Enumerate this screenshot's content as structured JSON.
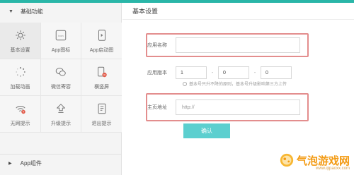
{
  "sidebar": {
    "section_title": "基础功能",
    "items": [
      {
        "label": "基本设置",
        "icon": "gear-icon"
      },
      {
        "label": "App图标",
        "icon": "app-icon-icon"
      },
      {
        "label": "App启动图",
        "icon": "launch-image-icon"
      },
      {
        "label": "加载动画",
        "icon": "loading-spinner-icon"
      },
      {
        "label": "微信寄容",
        "icon": "wechat-icon"
      },
      {
        "label": "横竖屏",
        "icon": "rotate-screen-icon"
      },
      {
        "label": "无网提示",
        "icon": "no-network-icon"
      },
      {
        "label": "升级提示",
        "icon": "upgrade-arrow-icon"
      },
      {
        "label": "退出提示",
        "icon": "exit-icon"
      }
    ],
    "sub_section_title": "App组件"
  },
  "main": {
    "title": "基本设置",
    "form": {
      "app_name_label": "应用名称",
      "app_name_value": "",
      "version_label": "应用版本",
      "version": [
        "1",
        "0",
        "0"
      ],
      "version_sep": "-",
      "version_hint": "基本号只升不降的原则，基本号升级影响第三方上传",
      "homepage_label": "主页地址",
      "homepage_placeholder": "http://",
      "confirm_label": "确认"
    }
  },
  "watermark": {
    "text": "气泡游戏网",
    "url": "www.qipaoxx.com"
  },
  "colors": {
    "accent": "#2ab6a8",
    "button": "#5ccfcf",
    "highlight_box": "#e38e8e",
    "watermark": "#f39a12"
  }
}
